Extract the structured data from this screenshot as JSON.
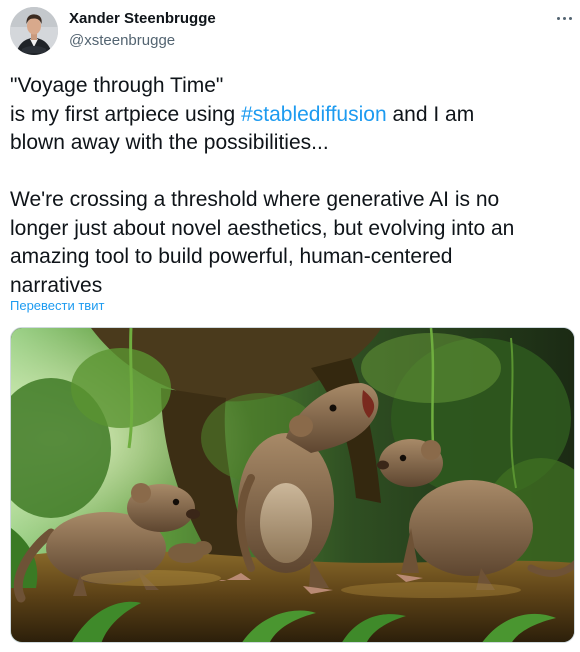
{
  "author": {
    "name": "Xander Steenbrugge",
    "handle": "@xsteenbrugge"
  },
  "tweet": {
    "line1": "\"Voyage through Time\"",
    "line2_before": "is my first artpiece using ",
    "hashtag": "#stablediffusion",
    "line2_after": " and I am",
    "line3": "blown away with the possibilities...",
    "line4": "We're crossing a threshold where generative AI is no",
    "line5": "longer just about novel aesthetics, but evolving into an",
    "line6": "amazing tool to build powerful, human-centered",
    "line7": "narratives"
  },
  "translate_label": "Перевести твит",
  "icons": {
    "more": "more-horizontal-icon"
  },
  "colors": {
    "link": "#1d9bf0",
    "text": "#0f1419",
    "secondary": "#536471"
  }
}
